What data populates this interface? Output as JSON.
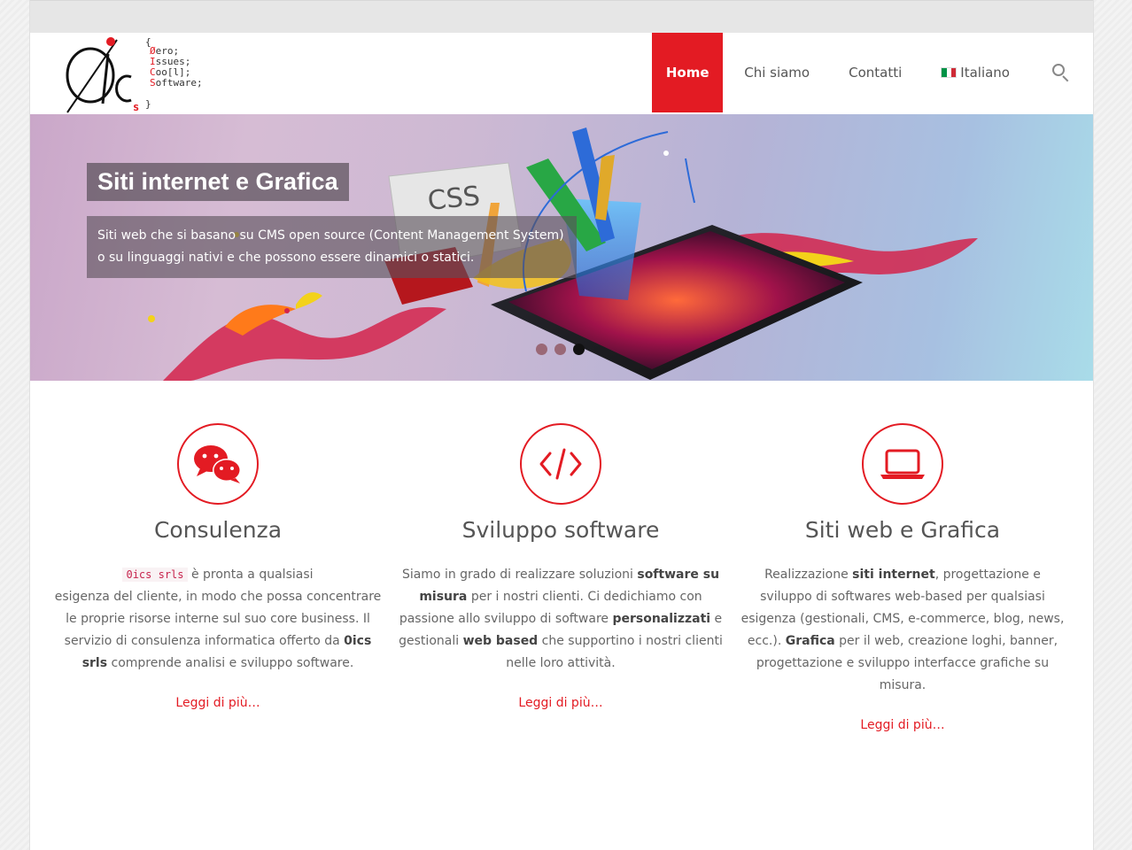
{
  "colors": {
    "accent": "#e31b23",
    "topbar": "#e6e6e6",
    "text": "#666666"
  },
  "logo": {
    "symbol": "0ics",
    "brace_open": "{",
    "brace_close": "}",
    "lines": [
      {
        "initial": "Ø",
        "rest": "ero;"
      },
      {
        "initial": "I",
        "rest": "ssues;"
      },
      {
        "initial": "C",
        "rest": "oo[l];"
      },
      {
        "initial": "S",
        "rest": "oftware;"
      }
    ]
  },
  "nav": {
    "home": "Home",
    "about": "Chi siamo",
    "contacts": "Contatti",
    "language": "Italiano",
    "search_icon": "search-icon"
  },
  "hero": {
    "title": "Siti internet e Grafica",
    "description": "Siti web che si basano su CMS open source (Content Management System) o su linguaggi nativi e che possono essere dinamici o statici.",
    "slides": 3,
    "active_slide": 3
  },
  "features": [
    {
      "icon": "chat-bubbles-icon",
      "title": "Consulenza",
      "code": "0ics srls",
      "text_a": " è pronta a qualsiasi",
      "text_b": "esigenza del cliente, in modo che possa concentrare le proprie risorse interne sul suo core business. Il servizio di consulenza informatica offerto da ",
      "bold_a": "0ics srls",
      "text_c": " comprende analisi e sviluppo software.",
      "more": "Leggi di più…"
    },
    {
      "icon": "code-icon",
      "title": "Sviluppo software",
      "text_a": "Siamo in grado di realizzare soluzioni ",
      "bold_a": "software su misura",
      "text_b": " per i nostri clienti. Ci dedichiamo con passione allo sviluppo di software ",
      "bold_b": "personalizzati",
      "text_c": " e gestionali ",
      "bold_c": "web based",
      "text_d": " che supportino i nostri clienti nelle loro attività.",
      "more": "Leggi di più…"
    },
    {
      "icon": "laptop-icon",
      "title": "Siti web e Grafica",
      "text_a": "Realizzazione ",
      "bold_a": "siti internet",
      "text_b": ", progettazione e sviluppo di softwares web-based per qualsiasi esigenza (gestionali, CMS, e-commerce, blog, news, ecc.). ",
      "bold_b": "Grafica",
      "text_c": " per il web, creazione loghi, banner, progettazione e sviluppo interfacce grafiche su misura.",
      "more": "Leggi di più…"
    }
  ]
}
